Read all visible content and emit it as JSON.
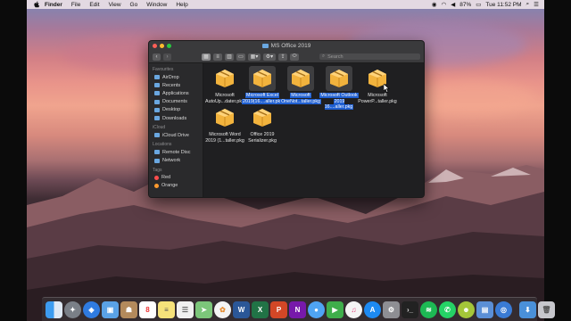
{
  "menubar": {
    "app": "Finder",
    "items": [
      "File",
      "Edit",
      "View",
      "Go",
      "Window",
      "Help"
    ],
    "battery": "87%",
    "clock": "Tue 11:52 PM"
  },
  "window": {
    "title": "MS Office 2019",
    "search_placeholder": "Search"
  },
  "sidebar": {
    "favourites_header": "Favourites",
    "favourites": [
      "AirDrop",
      "Recents",
      "Applications",
      "Documents",
      "Desktop",
      "Downloads"
    ],
    "icloud_header": "iCloud",
    "icloud": [
      "iCloud Drive"
    ],
    "locations_header": "Locations",
    "locations": [
      "Remote Disc",
      "Network"
    ],
    "tags_header": "Tags",
    "tags": [
      "Red",
      "Orange"
    ]
  },
  "files": [
    {
      "line1": "Microsoft",
      "line2": "AutoUp...dater.pkg",
      "selected": false
    },
    {
      "line1": "Microsoft Excel",
      "line2": "2019(16....aller.pkg",
      "selected": true
    },
    {
      "line1": "Microsoft",
      "line2": "OneNot...taller.pkg",
      "selected": true
    },
    {
      "line1": "Microsoft Outlook",
      "line2": "2019 16....aller.pkg",
      "selected": true
    },
    {
      "line1": "Microsoft",
      "line2": "PowerP...taller.pkg",
      "selected": false
    },
    {
      "line1": "Microsoft Word",
      "line2": "2019 (1...taller.pkg",
      "selected": false
    },
    {
      "line1": "Office 2019",
      "line2": "Serializer.pkg",
      "selected": false
    }
  ],
  "colors": {
    "selection": "#1f5fd1",
    "tag_red": "#ff4d4d",
    "tag_orange": "#ff9a2e",
    "package": "#f2b33d"
  },
  "dock_apps": [
    "finder-icon",
    "launchpad-icon",
    "safari-icon",
    "preview-icon",
    "contacts-icon",
    "calendar-icon",
    "notes-icon",
    "reminders-icon",
    "maps-icon",
    "photos-icon",
    "word-icon",
    "excel-icon",
    "powerpoint-icon",
    "onenote-icon",
    "messages-icon",
    "facetime-icon",
    "itunes-icon",
    "appstore-icon",
    "system-preferences-icon",
    "terminal-icon",
    "spotify-icon",
    "whatsapp-icon",
    "android-icon",
    "utility-icon",
    "network-icon",
    "downloads-stack-icon",
    "trash-icon"
  ]
}
